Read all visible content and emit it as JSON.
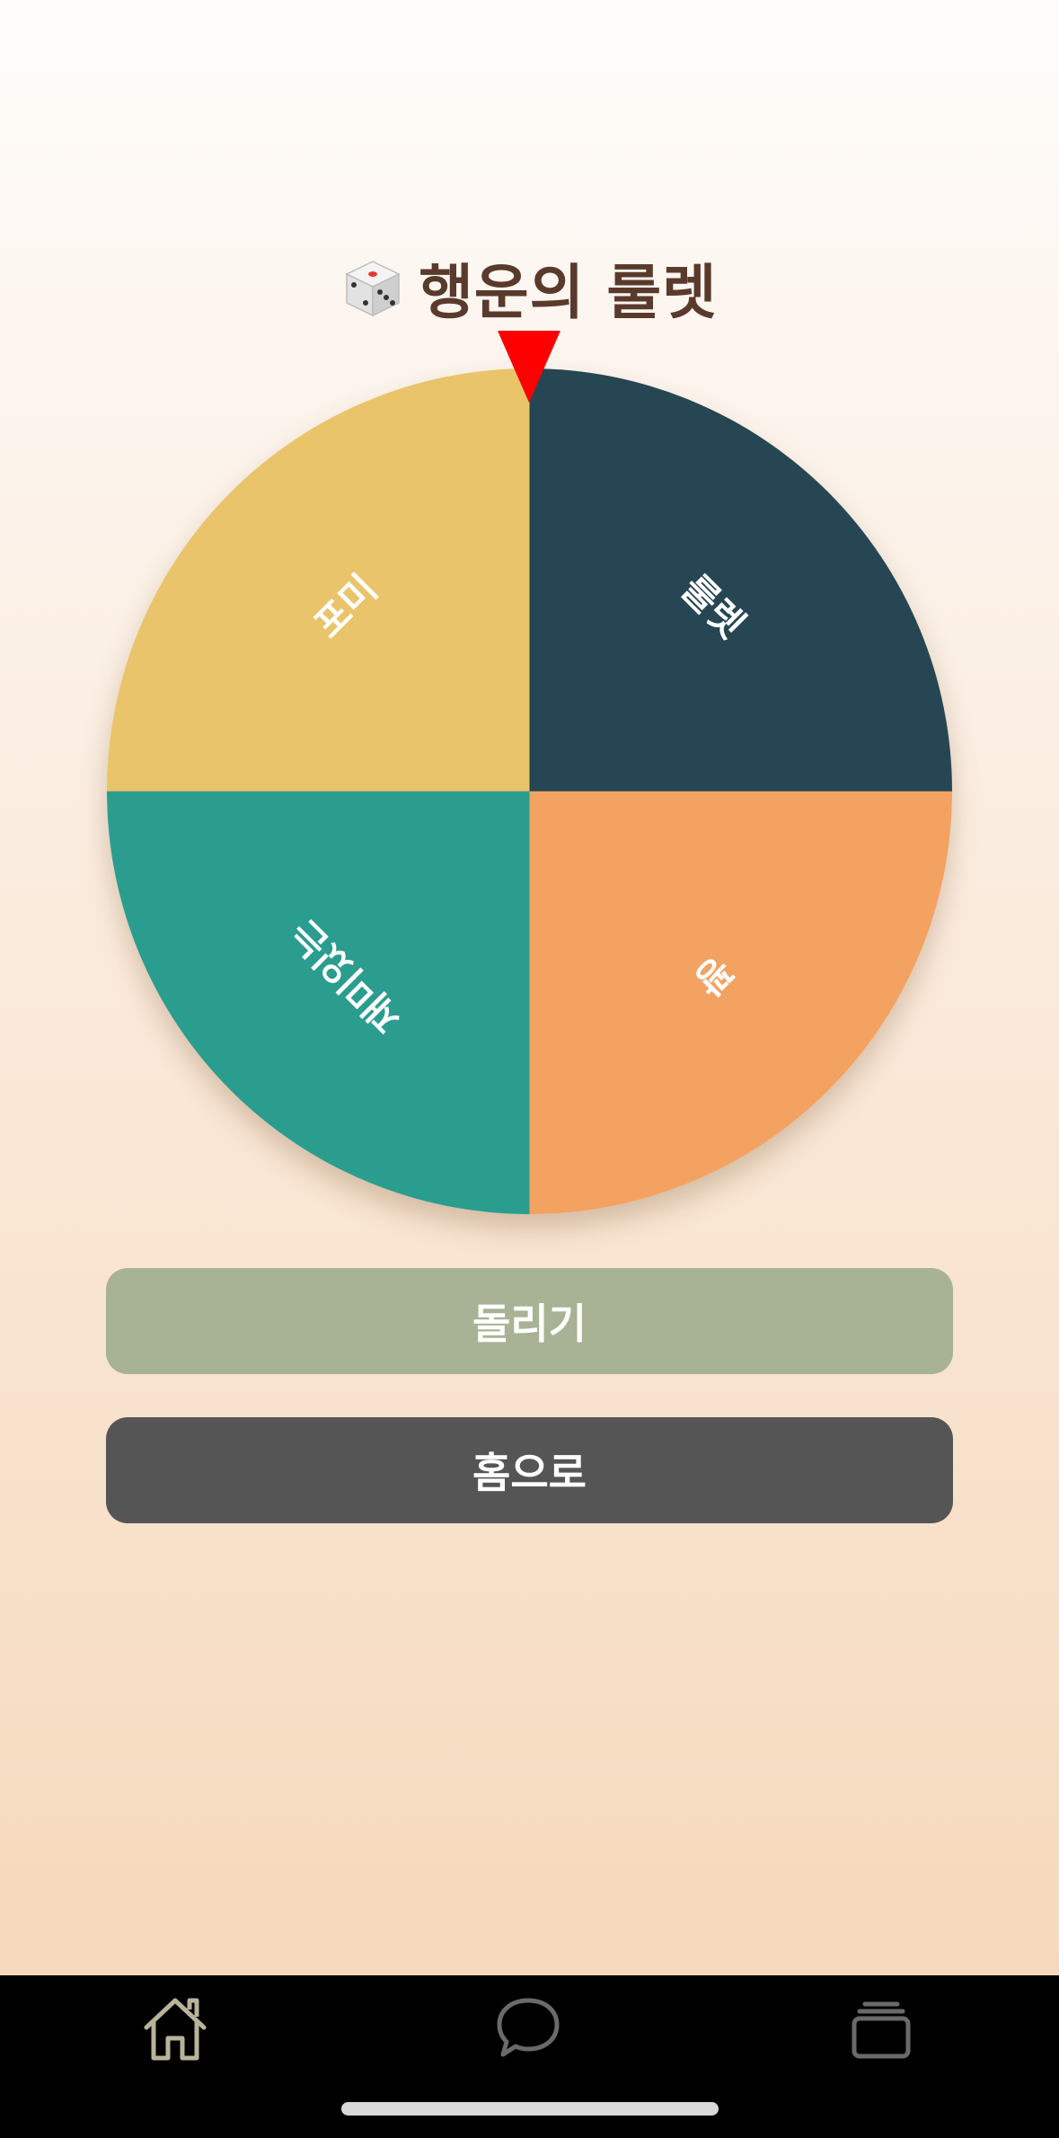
{
  "app": {
    "title": "행운의 룰렛",
    "title_icon": "dice-icon"
  },
  "wheel": {
    "segments": [
      {
        "label": "룰렛",
        "color": "#264653"
      },
      {
        "label": "꽝",
        "color": "#f4a261"
      },
      {
        "label": "재미있는",
        "color": "#2a9d8f"
      },
      {
        "label": "포미",
        "color": "#e9c46a"
      }
    ],
    "pointer_color": "#ff0000"
  },
  "buttons": {
    "spin_label": "돌리기",
    "home_label": "홈으로"
  },
  "tabbar": {
    "items": [
      {
        "icon": "home-icon"
      },
      {
        "icon": "chat-icon"
      },
      {
        "icon": "cards-icon"
      }
    ]
  }
}
